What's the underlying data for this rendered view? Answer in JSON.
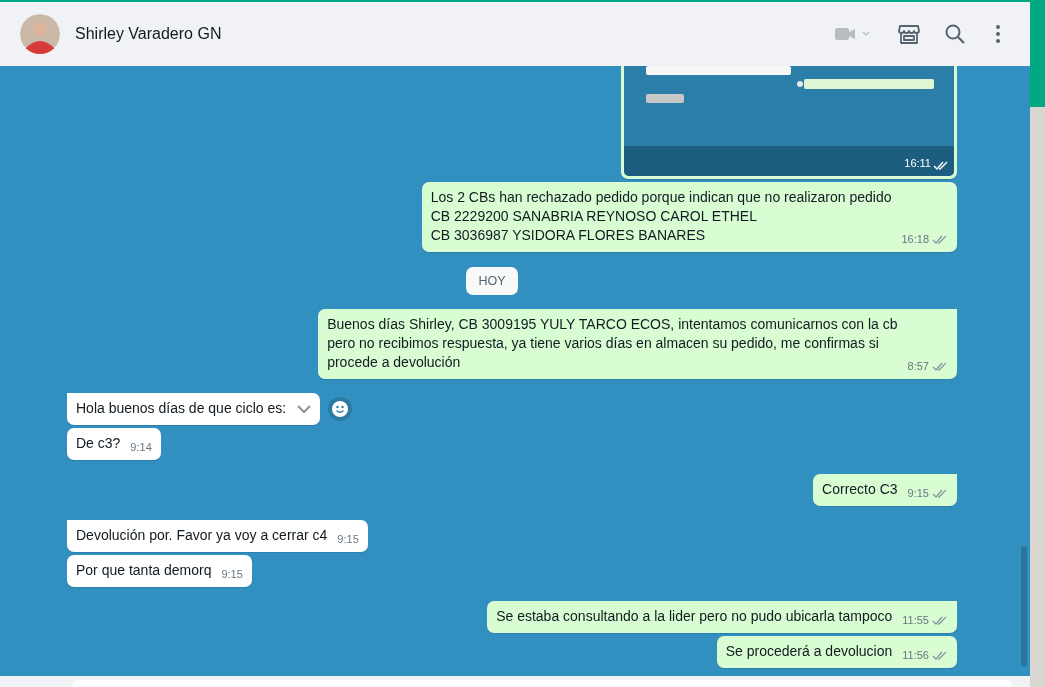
{
  "header": {
    "contact_name": "Shirley Varadero GN"
  },
  "messages": [
    {
      "outgoing": true,
      "tail": false,
      "time": "16:11"
    },
    {
      "kind": "text",
      "outgoing": true,
      "tail": false,
      "lines": [
        "Los 2 CBs han rechazado pedido porque indican que no realizaron pedido",
        "CB 2229200 SANABRIA REYNOSO CAROL ETHEL",
        "CB 3036987 YSIDORA FLORES BANARES"
      ],
      "time": "16:18"
    },
    {
      "kind": "date",
      "label": "HOY"
    },
    {
      "kind": "text",
      "outgoing": true,
      "tail": true,
      "lines": [
        "Buenos días Shirley, CB 3009195 YULY TARCO ECOS, intentamos comunicarnos con la cb",
        "pero no recibimos respuesta, ya tiene varios días en almacen su pedido, me confirmas si",
        "procede a devolución"
      ],
      "time": "8:57"
    },
    {
      "kind": "hovered",
      "outgoing": false,
      "tail": true,
      "lines": [
        "Hola buenos días de que ciclo es:"
      ]
    },
    {
      "kind": "text",
      "outgoing": false,
      "tail": false,
      "lines": [
        "De c3?"
      ],
      "time": "9:14"
    },
    {
      "kind": "text",
      "outgoing": true,
      "tail": true,
      "lines": [
        "Correcto C3"
      ],
      "time": "9:15"
    },
    {
      "kind": "text",
      "outgoing": false,
      "tail": true,
      "lines": [
        "Devolución por. Favor ya voy a cerrar c4"
      ],
      "time": "9:15"
    },
    {
      "kind": "text",
      "outgoing": false,
      "tail": false,
      "lines": [
        "Por que tanta demorq"
      ],
      "time": "9:15"
    },
    {
      "kind": "text",
      "outgoing": true,
      "tail": true,
      "lines": [
        "Se estaba consultando a la lider pero no pudo ubicarla tampoco"
      ],
      "time": "11:55"
    },
    {
      "kind": "text",
      "outgoing": true,
      "tail": false,
      "lines": [
        "Se procederá a devolucion"
      ],
      "time": "11:56"
    }
  ]
}
